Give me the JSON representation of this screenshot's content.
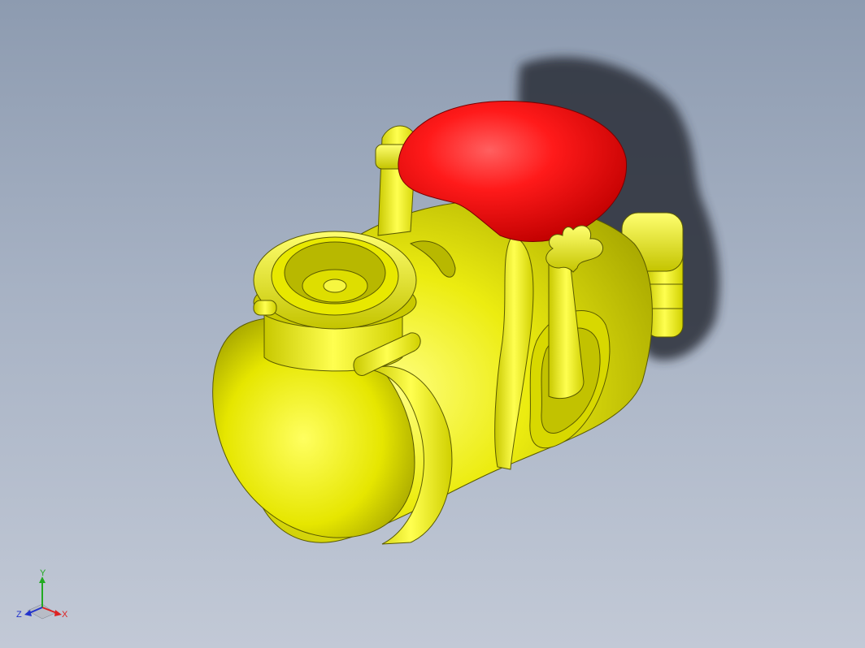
{
  "viewport": {
    "background_top": "#8d9bb0",
    "background_bottom": "#c2c9d6"
  },
  "model": {
    "body_color": "#f0f000",
    "heart_color": "#ff1414",
    "shadow_color": "#2a2f38"
  },
  "triad": {
    "y_label": "Y",
    "x_label": "X",
    "z_label": "Z",
    "y_color": "#22aa22",
    "x_color": "#dd2222",
    "z_color": "#2233cc"
  }
}
